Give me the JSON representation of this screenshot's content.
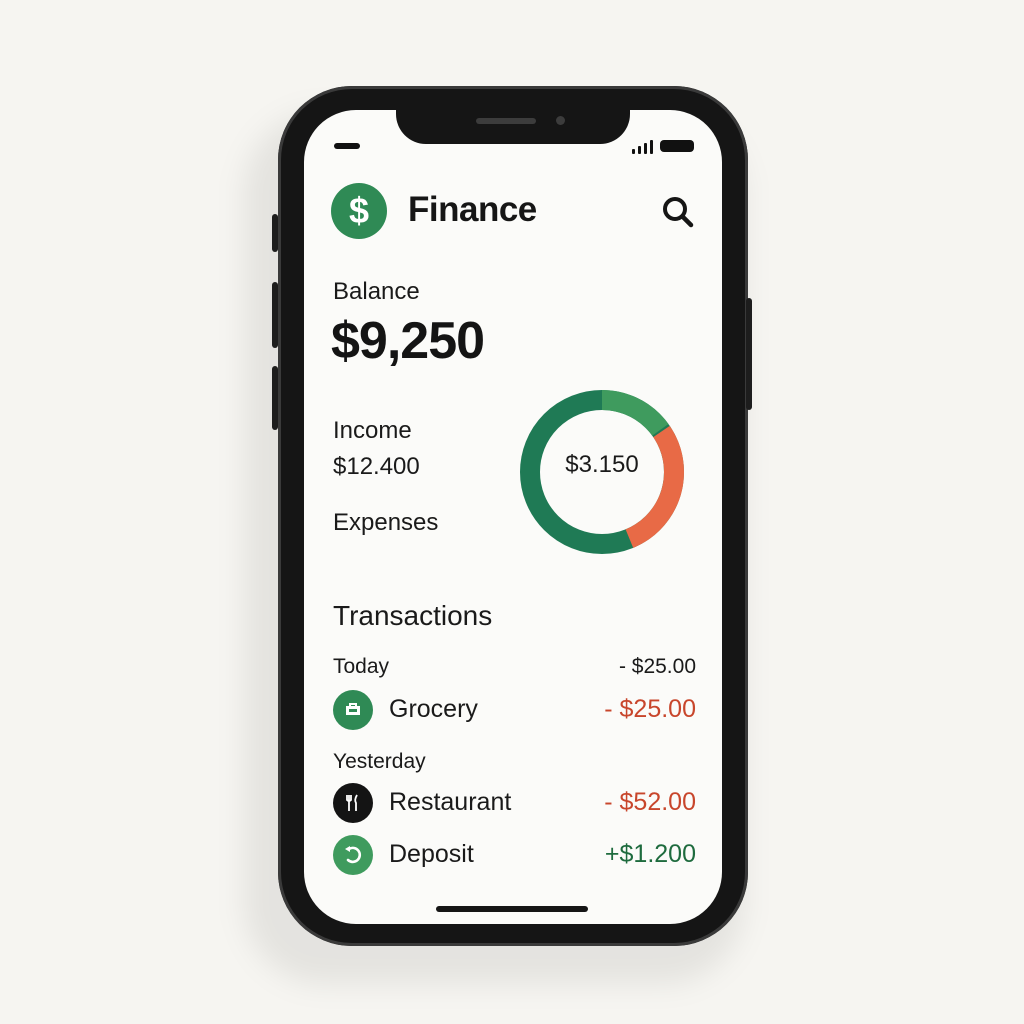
{
  "app": {
    "title": "Finance",
    "logo_icon": "dollar-icon",
    "logo_glyph": "$",
    "search_icon": "search-icon"
  },
  "balance": {
    "label": "Balance",
    "value": "$9,250"
  },
  "summary": {
    "income_label": "Income",
    "income_value": "$12.400",
    "expenses_label": "Expenses",
    "donut_center": "$3.150",
    "donut_colors": {
      "primary": "#1f7a55",
      "secondary": "#3f9b5e",
      "expense": "#e86a46"
    }
  },
  "transactions": {
    "title": "Transactions",
    "groups": [
      {
        "label": "Today",
        "total": "- $25.00",
        "items": [
          {
            "name": "Grocery",
            "amount": "- $25.00",
            "icon": "grocery-icon",
            "type": "debit"
          }
        ]
      },
      {
        "label": "Yesterday",
        "items": [
          {
            "name": "Restaurant",
            "amount": "- $52.00",
            "icon": "restaurant-icon",
            "type": "debit"
          },
          {
            "name": "Deposit",
            "amount": "+$1.200",
            "icon": "deposit-icon",
            "type": "credit"
          }
        ]
      }
    ]
  },
  "colors": {
    "brand": "#2f8a55",
    "debit": "#c8462c",
    "credit": "#1e6b3e"
  }
}
